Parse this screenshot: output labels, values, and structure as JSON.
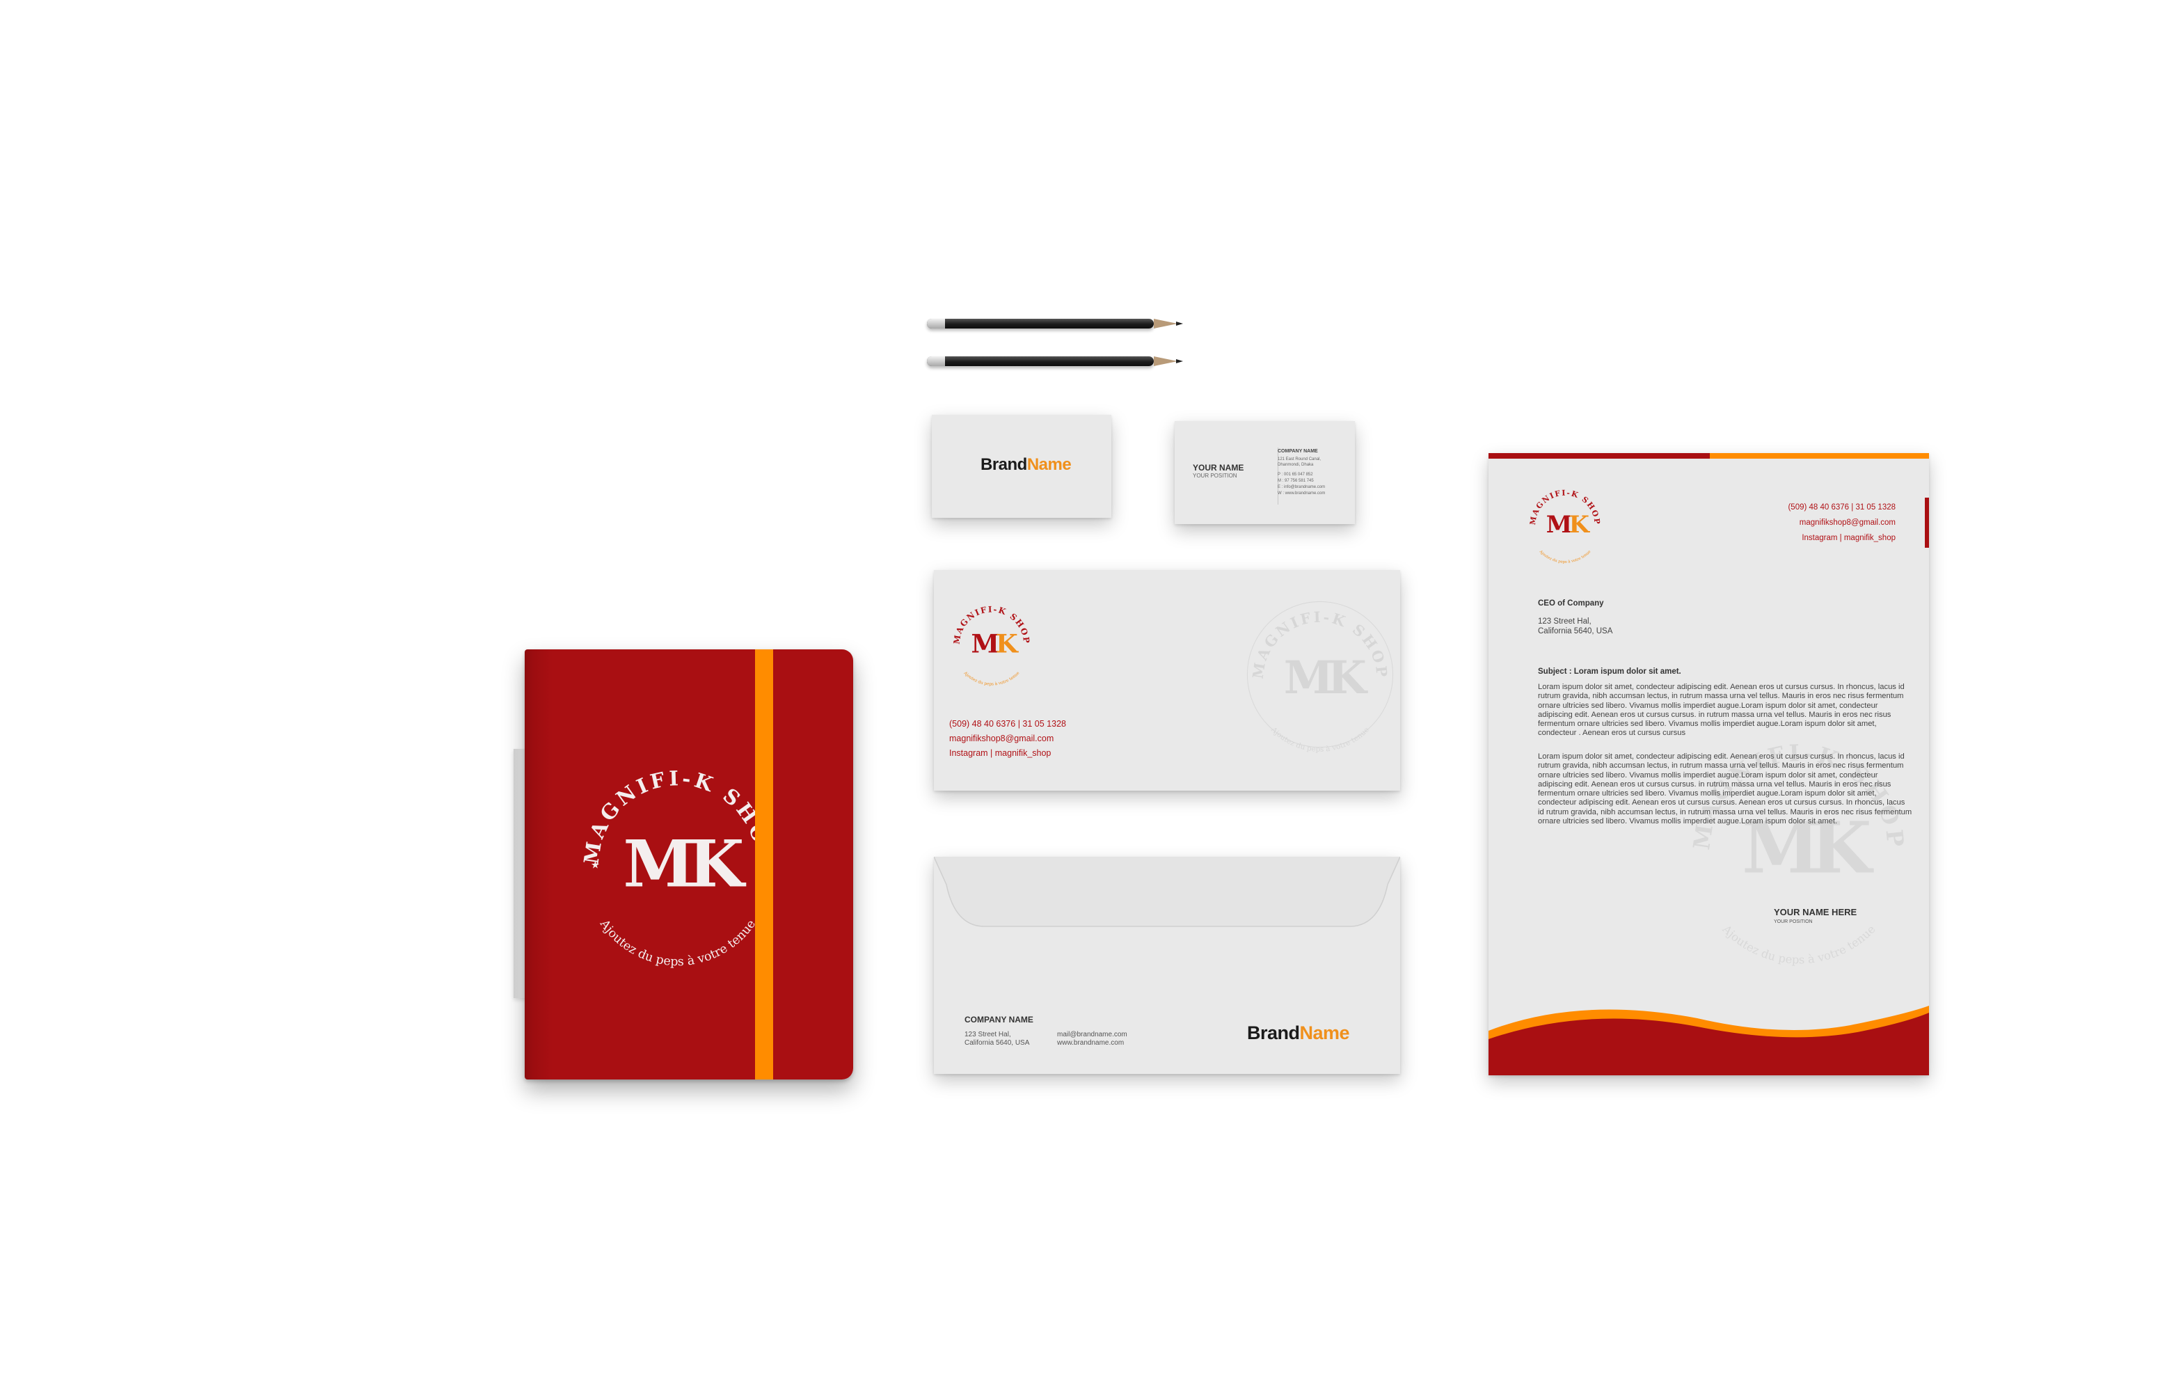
{
  "brand": {
    "name_part1": "Brand",
    "name_part2": "Name",
    "logo_ring_text": "MAGNIFI-K SHOP",
    "logo_monogram": "MK",
    "logo_tagline": "Ajoutez du peps à votre tenue"
  },
  "colors": {
    "primary_red": "#a90f12",
    "accent_orange": "#ff8c00",
    "paper": "#e9e9e9"
  },
  "business_card_back": {
    "name": "YOUR NAME",
    "position": "YOUR POSITION",
    "company": "COMPANY NAME",
    "address_1": "121 East Round Canal,",
    "address_2": "Dhanmondi, Dhaka",
    "phone": "P : 001 65 047 852",
    "mobile": "M : 97 756 581 745",
    "email": "E : info@brandname.com",
    "web": "W : www.brandname.com"
  },
  "contact": {
    "phone": "(509)  48 40 6376 | 31 05 1328",
    "email": "magnifikshop8@gmail.com",
    "instagram": "Instagram | magnifik_shop"
  },
  "envelope_back": {
    "company": "COMPANY NAME",
    "address_1": "123 Street Hal,",
    "address_2": "California 5640, USA",
    "email": "mail@brandname.com",
    "web": "www.brandname.com"
  },
  "letterhead": {
    "recipient_title": "CEO of Company",
    "recipient_address_1": "123 Street Hal,",
    "recipient_address_2": "California 5640, USA",
    "subject": "Subject : Loram ispum dolor sit amet.",
    "paragraph_1": [
      "Loram ispum dolor sit amet, condecteur adipiscing edit. Aenean eros ut cursus cursus. In rhoncus, lacus id",
      "rutrum gravida, nibh accumsan lectus, in rutrum massa urna vel tellus. Mauris in eros nec risus fermentum",
      "ornare ultricies sed libero. Vivamus mollis imperdiet augue.Loram ispum dolor sit amet, condecteur",
      "adipiscing edit. Aenean eros ut cursus cursus. in rutrum massa urna vel tellus. Mauris in eros nec risus",
      "fermentum ornare ultricies sed libero. Vivamus mollis imperdiet augue.Loram ispum dolor sit amet,",
      "condecteur . Aenean eros ut cursus cursus"
    ],
    "paragraph_2": [
      "Loram ispum dolor sit amet, condecteur adipiscing edit. Aenean eros ut cursus cursus. In rhoncus, lacus id",
      "rutrum gravida, nibh accumsan lectus, in rutrum massa urna vel tellus. Mauris in eros nec risus fermentum",
      "ornare ultricies sed libero. Vivamus mollis imperdiet augue.Loram ispum dolor sit amet, condecteur",
      "adipiscing edit. Aenean eros ut cursus cursus. in rutrum massa urna vel tellus. Mauris in eros nec risus",
      "fermentum ornare ultricies sed libero. Vivamus mollis imperdiet augue.Loram ispum dolor sit amet,",
      "condecteur adipiscing edit. Aenean eros ut cursus cursus.  Aenean eros ut cursus cursus. In rhoncus, lacus",
      "id rutrum gravida, nibh accumsan lectus, in rutrum massa urna vel tellus. Mauris in eros nec risus fermentum",
      "ornare ultricies sed libero. Vivamus mollis imperdiet augue.Loram ispum dolor sit amet."
    ],
    "signature_name": "YOUR NAME HERE",
    "signature_position": "YOUR POSITION"
  }
}
